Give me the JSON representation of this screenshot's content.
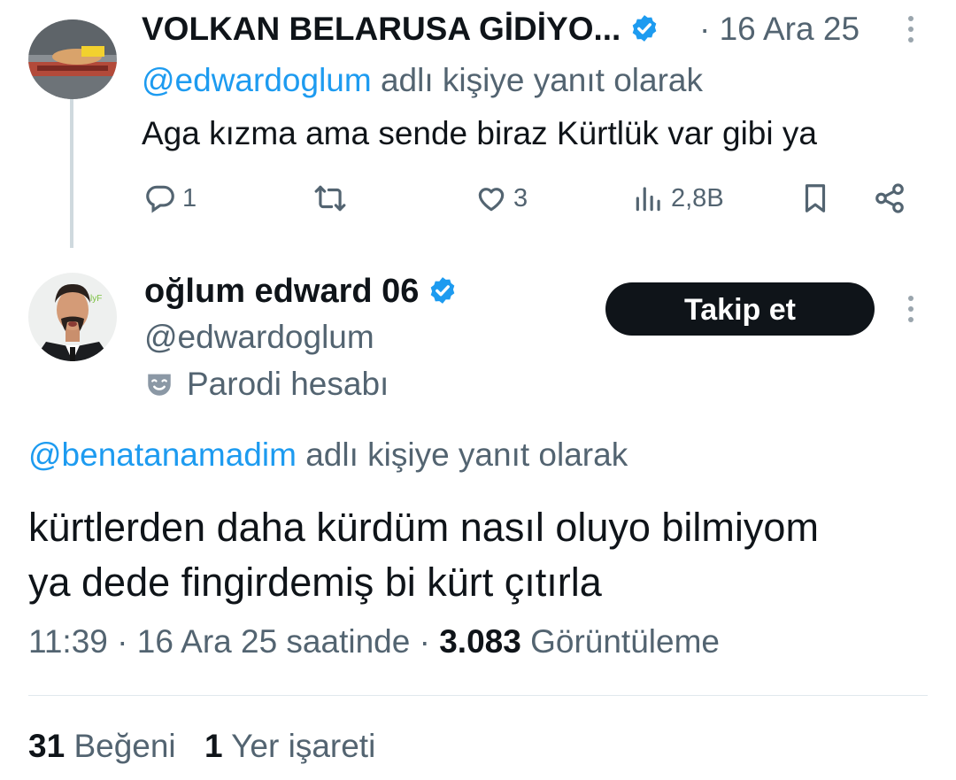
{
  "parent_tweet": {
    "author_name": "VOLKAN BELARUSA GİDİYO...",
    "separator": "·",
    "date": "16 Ara 25",
    "reply_to_handle": "@edwardoglum",
    "reply_to_suffix": "adlı kişiye yanıt olarak",
    "text": "Aga kızma ama sende biraz Kürtlük var gibi ya",
    "actions": {
      "replies": "1",
      "retweets": "",
      "likes": "3",
      "views": "2,8B"
    }
  },
  "main_tweet": {
    "author_name": "oğlum edward 06",
    "handle": "@edwardoglum",
    "parody_label": "Parodi hesabı",
    "follow_label": "Takip et",
    "reply_to_handle": "@benatanamadim",
    "reply_to_suffix": "adlı kişiye yanıt olarak",
    "text_line1": "kürtlerden daha kürdüm nasıl oluyo bilmiyom",
    "text_line2": "ya dede fingirdemiş bi kürt çıtırla",
    "time": "11:39",
    "meta_sep": "·",
    "date_text": "16 Ara 25 saatinde",
    "views_count": "3.083",
    "views_label": "Görüntüleme",
    "likes_count": "31",
    "likes_label": "Beğeni",
    "bookmarks_count": "1",
    "bookmarks_label": "Yer işareti"
  },
  "icons": {
    "verified": "verified-badge-icon",
    "reply": "reply-icon",
    "retweet": "retweet-icon",
    "like": "heart-icon",
    "views": "views-icon",
    "bookmark": "bookmark-icon",
    "share": "share-icon",
    "more": "more-vertical-icon",
    "parody": "parody-mask-icon"
  },
  "colors": {
    "accent": "#1d9bf0",
    "text": "#0f1419",
    "secondary": "#536471",
    "follow_bg": "#0f1419"
  }
}
